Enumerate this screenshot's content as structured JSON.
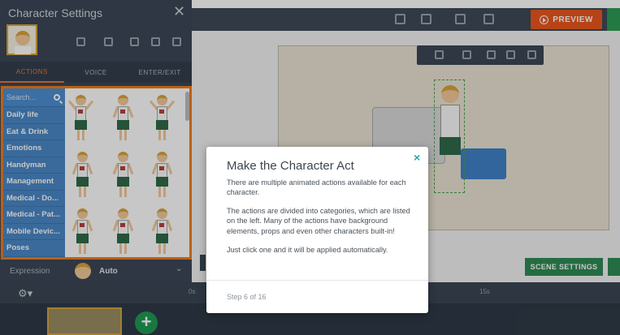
{
  "panel": {
    "title": "Character Settings",
    "close_glyph": "✕",
    "tabs": [
      {
        "label": "ACTIONS",
        "active": true
      },
      {
        "label": "VOICE",
        "active": false
      },
      {
        "label": "ENTER/EXIT",
        "active": false
      }
    ],
    "search_placeholder": "Search...",
    "categories": [
      "Daily life",
      "Eat & Drink",
      "Emotions",
      "Handyman",
      "Management",
      "Medical - Do...",
      "Medical - Pat...",
      "Mobile Devic...",
      "Poses"
    ],
    "expression_label": "Expression",
    "expression_value": "Auto",
    "chevron": "⌄"
  },
  "toolbar": {
    "preview_label": "PREVIEW"
  },
  "stage": {
    "scene_settings_label": "SCENE SETTINGS"
  },
  "timeline": {
    "gear_glyph": "⚙▾",
    "ticks": [
      "0s",
      "15s"
    ],
    "add_glyph": "+"
  },
  "tour": {
    "close_glyph": "×",
    "title": "Make the Character Act",
    "paragraphs": [
      "There are multiple animated actions available for each character.",
      "The actions are divided into categories, which are listed on the left. Many of the actions have background elements, props and even other characters built-in!",
      "Just click one and it will be applied automatically."
    ],
    "step": "Step 6 of 16"
  },
  "colors": {
    "accent_orange": "#f07d1d",
    "category_blue": "#4a88c7",
    "tour_teal": "#2aa8a0",
    "scene_green": "#2f8b55"
  }
}
